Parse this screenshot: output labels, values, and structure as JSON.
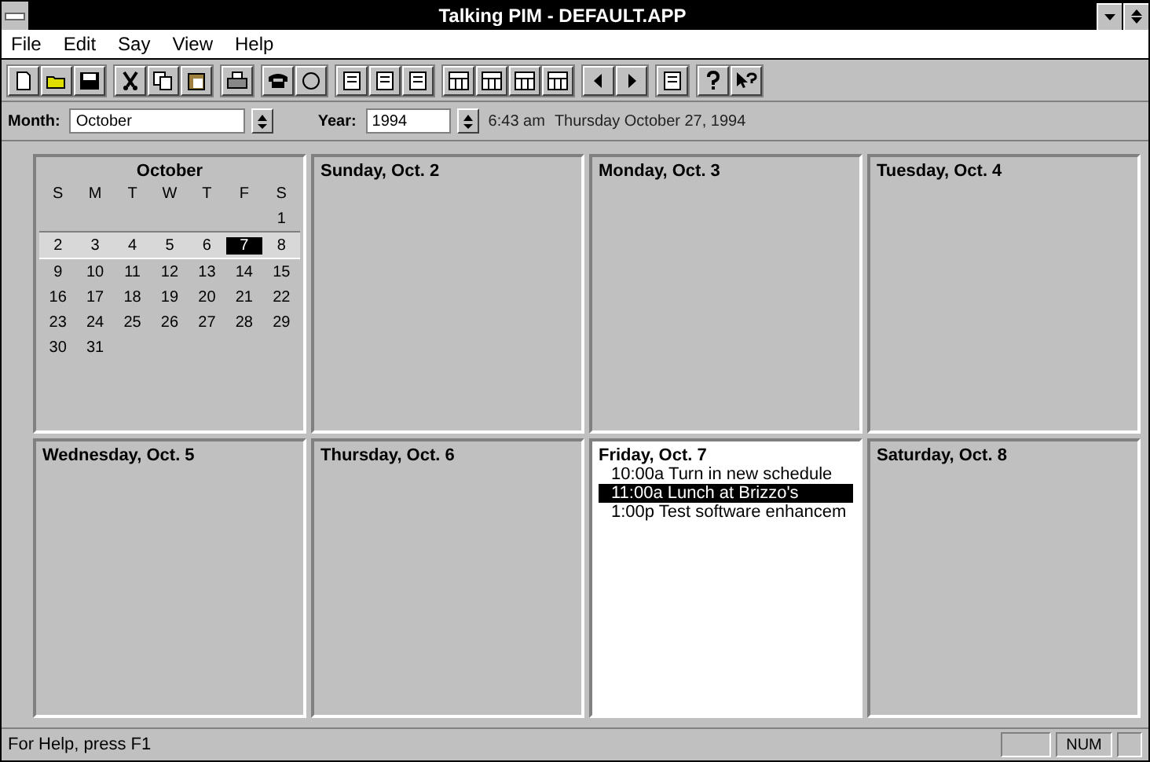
{
  "window": {
    "title": "Talking PIM - DEFAULT.APP"
  },
  "menu": [
    "File",
    "Edit",
    "Say",
    "View",
    "Help"
  ],
  "month_bar": {
    "month_label": "Month:",
    "month": "October",
    "year_label": "Year:",
    "year": "1994",
    "time": "6:43 am",
    "date": "Thursday October 27, 1994"
  },
  "mini_calendar": {
    "title": "October",
    "weekdays": [
      "S",
      "M",
      "T",
      "W",
      "T",
      "F",
      "S"
    ],
    "weeks": [
      {
        "selected": false,
        "days": [
          {
            "label": "1",
            "selected": false
          }
        ]
      },
      {
        "selected": true,
        "days": [
          {
            "label": "2",
            "selected": false
          },
          {
            "label": "3",
            "selected": false
          },
          {
            "label": "4",
            "selected": false
          },
          {
            "label": "5",
            "selected": false
          },
          {
            "label": "6",
            "selected": false
          },
          {
            "label": "7",
            "selected": true
          },
          {
            "label": "8",
            "selected": false
          }
        ]
      },
      {
        "selected": false,
        "days": [
          {
            "label": "9",
            "selected": false
          },
          {
            "label": "10",
            "selected": false
          },
          {
            "label": "11",
            "selected": false
          },
          {
            "label": "12",
            "selected": false
          },
          {
            "label": "13",
            "selected": false
          },
          {
            "label": "14",
            "selected": false
          },
          {
            "label": "15",
            "selected": false
          }
        ]
      },
      {
        "selected": false,
        "days": [
          {
            "label": "16",
            "selected": false
          },
          {
            "label": "17",
            "selected": false
          },
          {
            "label": "18",
            "selected": false
          },
          {
            "label": "19",
            "selected": false
          },
          {
            "label": "20",
            "selected": false
          },
          {
            "label": "21",
            "selected": false
          },
          {
            "label": "22",
            "selected": false
          }
        ]
      },
      {
        "selected": false,
        "days": [
          {
            "label": "23",
            "selected": false
          },
          {
            "label": "24",
            "selected": false
          },
          {
            "label": "25",
            "selected": false
          },
          {
            "label": "26",
            "selected": false
          },
          {
            "label": "27",
            "selected": false
          },
          {
            "label": "28",
            "selected": false
          },
          {
            "label": "29",
            "selected": false
          }
        ]
      },
      {
        "selected": false,
        "days": [
          {
            "label": "30",
            "selected": false
          },
          {
            "label": "31",
            "selected": false
          }
        ]
      }
    ]
  },
  "days": [
    {
      "label": "Sunday, Oct. 2",
      "selected": false
    },
    {
      "label": "Monday, Oct. 3",
      "selected": false
    },
    {
      "label": "Tuesday, Oct. 4",
      "selected": false
    },
    {
      "label": "Wednesday, Oct. 5",
      "selected": false
    },
    {
      "label": "Thursday, Oct. 6",
      "selected": false
    },
    {
      "label": "Friday, Oct. 7",
      "selected": true,
      "entries": [
        {
          "text": "10:00a Turn in new schedule",
          "selected": false
        },
        {
          "text": "11:00a Lunch at Brizzo's",
          "selected": true
        },
        {
          "text": "1:00p Test software enhancem",
          "selected": false
        }
      ]
    },
    {
      "label": "Saturday, Oct. 8",
      "selected": false
    }
  ],
  "status_bar": {
    "message": "For Help, press F1",
    "indicator": "NUM"
  }
}
